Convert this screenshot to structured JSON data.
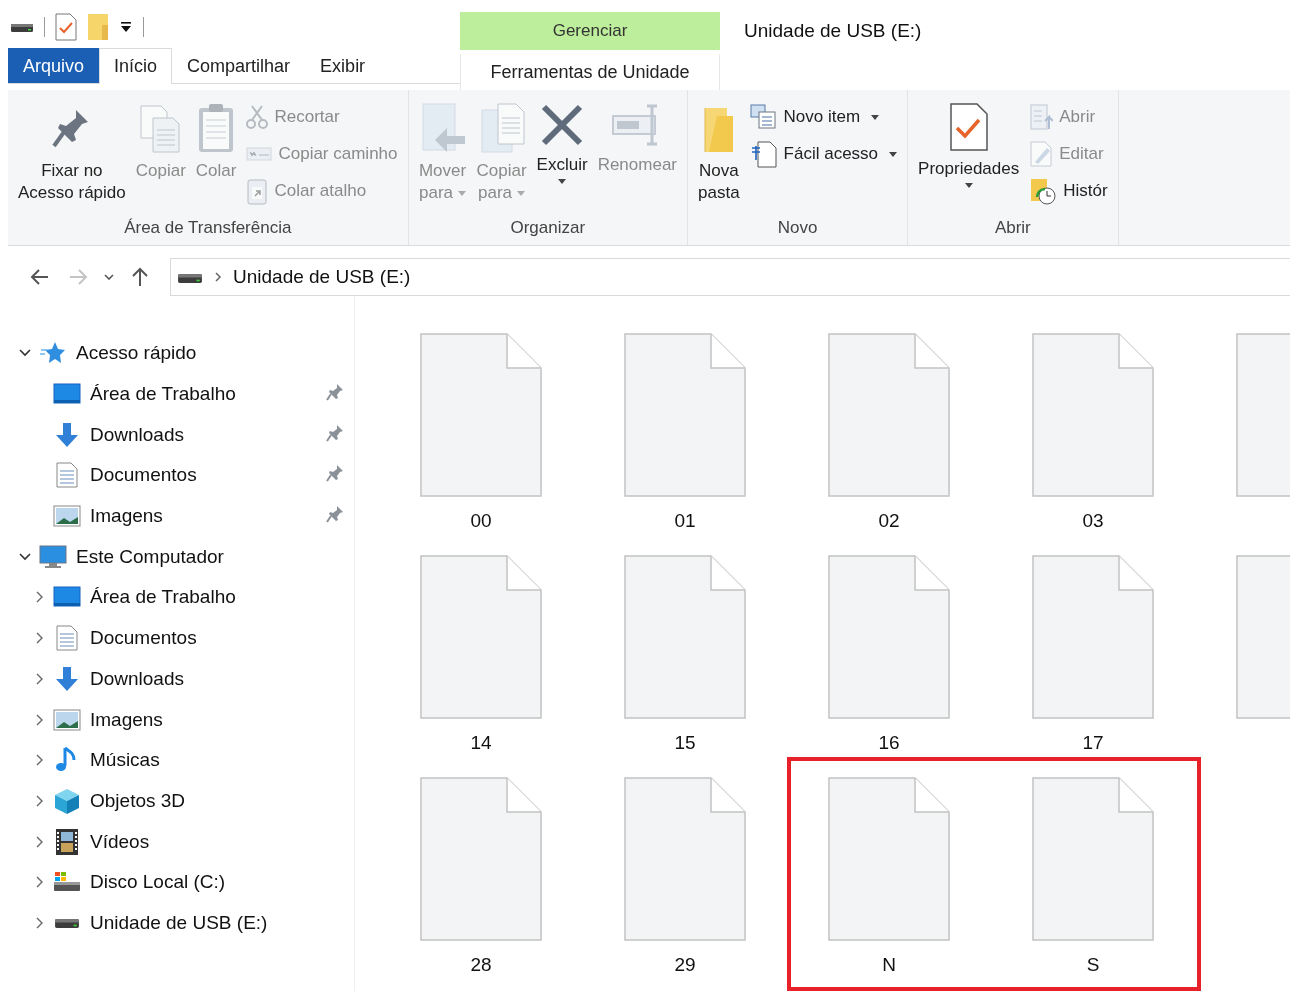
{
  "window": {
    "title": "Unidade de USB (E:)"
  },
  "context_group": "Gerenciar",
  "tabs": [
    {
      "label": "Arquivo",
      "kind": "file",
      "selected": false
    },
    {
      "label": "Início",
      "kind": "normal",
      "selected": true
    },
    {
      "label": "Compartilhar",
      "kind": "normal",
      "selected": false
    },
    {
      "label": "Exibir",
      "kind": "normal",
      "selected": false
    },
    {
      "label": "Ferramentas de Unidade",
      "kind": "context",
      "selected": false
    }
  ],
  "ribbon": [
    {
      "name": "Área de Transferência",
      "items": [
        {
          "kind": "large",
          "label": "Fixar no\nAcesso rápido",
          "disabled": false,
          "dropdown": false
        },
        {
          "kind": "large",
          "label": "Copiar",
          "disabled": true,
          "dropdown": false
        },
        {
          "kind": "large",
          "label": "Colar",
          "disabled": true,
          "dropdown": false
        },
        {
          "kind": "small",
          "label": "Recortar",
          "disabled": true,
          "dropdown": false
        },
        {
          "kind": "small",
          "label": "Copiar caminho",
          "disabled": true,
          "dropdown": false
        },
        {
          "kind": "small",
          "label": "Colar atalho",
          "disabled": true,
          "dropdown": false
        }
      ]
    },
    {
      "name": "Organizar",
      "items": [
        {
          "kind": "large",
          "label": "Mover\npara",
          "disabled": true,
          "dropdown": true
        },
        {
          "kind": "large",
          "label": "Copiar\npara",
          "disabled": true,
          "dropdown": true
        },
        {
          "kind": "large",
          "label": "Excluir",
          "disabled": false,
          "dropdown": true
        },
        {
          "kind": "large",
          "label": "Renomear",
          "disabled": true,
          "dropdown": false
        }
      ]
    },
    {
      "name": "Novo",
      "items": [
        {
          "kind": "large",
          "label": "Nova\npasta",
          "disabled": false,
          "dropdown": false
        },
        {
          "kind": "small",
          "label": "Novo item",
          "disabled": false,
          "dropdown": true
        },
        {
          "kind": "small",
          "label": "Fácil acesso",
          "disabled": false,
          "dropdown": true
        }
      ]
    },
    {
      "name": "Abrir",
      "items": [
        {
          "kind": "large",
          "label": "Propriedades",
          "disabled": false,
          "dropdown": true
        },
        {
          "kind": "small",
          "label": "Abrir",
          "disabled": true,
          "dropdown": false
        },
        {
          "kind": "small",
          "label": "Editar",
          "disabled": true,
          "dropdown": false
        },
        {
          "kind": "small",
          "label": "Histór",
          "disabled": false,
          "dropdown": false
        }
      ]
    }
  ],
  "address_bar": {
    "back_disabled": false,
    "forward_disabled": true,
    "path": "Unidade de USB (E:)"
  },
  "navigation": [
    {
      "label": "Acesso rápido",
      "kind": "quickaccess",
      "expanded": true,
      "children": [
        {
          "label": "Área de Trabalho",
          "kind": "desktop",
          "pinned": true
        },
        {
          "label": "Downloads",
          "kind": "downloads",
          "pinned": true
        },
        {
          "label": "Documentos",
          "kind": "documents",
          "pinned": true
        },
        {
          "label": "Imagens",
          "kind": "pictures",
          "pinned": true
        }
      ]
    },
    {
      "label": "Este Computador",
      "kind": "computer",
      "expanded": true,
      "children": [
        {
          "label": "Área de Trabalho",
          "kind": "desktop",
          "expanded": false
        },
        {
          "label": "Documentos",
          "kind": "documents",
          "expanded": false
        },
        {
          "label": "Downloads",
          "kind": "downloads",
          "expanded": false
        },
        {
          "label": "Imagens",
          "kind": "pictures",
          "expanded": false
        },
        {
          "label": "Músicas",
          "kind": "music",
          "expanded": false
        },
        {
          "label": "Objetos 3D",
          "kind": "objects3d",
          "expanded": false
        },
        {
          "label": "Vídeos",
          "kind": "videos",
          "expanded": false
        },
        {
          "label": "Disco Local (C:)",
          "kind": "disk",
          "expanded": false
        },
        {
          "label": "Unidade de USB (E:)",
          "kind": "usb",
          "expanded": false
        }
      ]
    }
  ],
  "files": [
    {
      "kind": "file",
      "name": "00",
      "highlighted": false
    },
    {
      "kind": "file",
      "name": "01",
      "highlighted": false
    },
    {
      "kind": "file",
      "name": "02",
      "highlighted": false
    },
    {
      "kind": "file",
      "name": "03",
      "highlighted": false
    },
    {
      "kind": "cut"
    },
    {
      "kind": "file",
      "name": "14",
      "highlighted": false
    },
    {
      "kind": "file",
      "name": "15",
      "highlighted": false
    },
    {
      "kind": "file",
      "name": "16",
      "highlighted": false
    },
    {
      "kind": "file",
      "name": "17",
      "highlighted": false
    },
    {
      "kind": "cut"
    },
    {
      "kind": "file",
      "name": "28",
      "highlighted": false
    },
    {
      "kind": "file",
      "name": "29",
      "highlighted": false
    },
    {
      "kind": "file",
      "name": "N",
      "highlighted": true
    },
    {
      "kind": "file",
      "name": "S",
      "highlighted": true
    }
  ]
}
